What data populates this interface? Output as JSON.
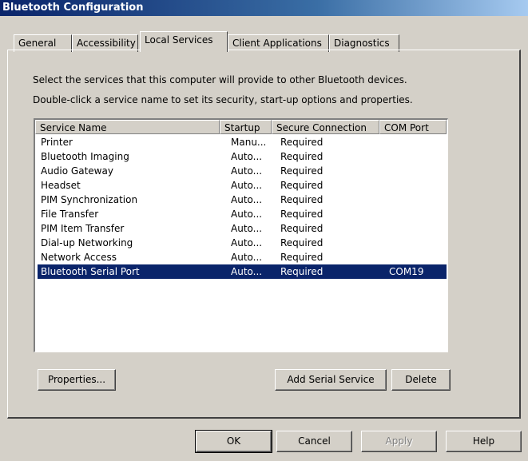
{
  "window": {
    "title": "Bluetooth Configuration"
  },
  "tabs": [
    {
      "label": "General",
      "active": false
    },
    {
      "label": "Accessibility",
      "active": false
    },
    {
      "label": "Local Services",
      "active": true
    },
    {
      "label": "Client Applications",
      "active": false
    },
    {
      "label": "Diagnostics",
      "active": false
    }
  ],
  "description": {
    "line1": "Select the services that this computer will provide to other Bluetooth devices.",
    "line2": "Double-click a service name to set its security, start-up options and properties."
  },
  "table": {
    "columns": [
      "Service Name",
      "Startup",
      "Secure Connection",
      "COM Port"
    ],
    "rows": [
      [
        "Printer",
        "Manu...",
        "Required",
        ""
      ],
      [
        "Bluetooth Imaging",
        "Auto...",
        "Required",
        ""
      ],
      [
        "Audio Gateway",
        "Auto...",
        "Required",
        ""
      ],
      [
        "Headset",
        "Auto...",
        "Required",
        ""
      ],
      [
        "PIM Synchronization",
        "Auto...",
        "Required",
        ""
      ],
      [
        "File Transfer",
        "Auto...",
        "Required",
        ""
      ],
      [
        "PIM Item Transfer",
        "Auto...",
        "Required",
        ""
      ],
      [
        "Dial-up Networking",
        "Auto...",
        "Required",
        ""
      ],
      [
        "Network Access",
        "Auto...",
        "Required",
        ""
      ],
      [
        "Bluetooth Serial Port",
        "Auto...",
        "Required",
        "COM19"
      ]
    ],
    "selected_row": 9
  },
  "buttons": {
    "properties": "Properties...",
    "add_serial_service": "Add Serial Service",
    "delete": "Delete",
    "ok": "OK",
    "cancel": "Cancel",
    "apply": "Apply",
    "help": "Help"
  },
  "colors": {
    "face": "#d4d0c8",
    "selection": "#0a246a",
    "title_start": "#0a246a"
  }
}
